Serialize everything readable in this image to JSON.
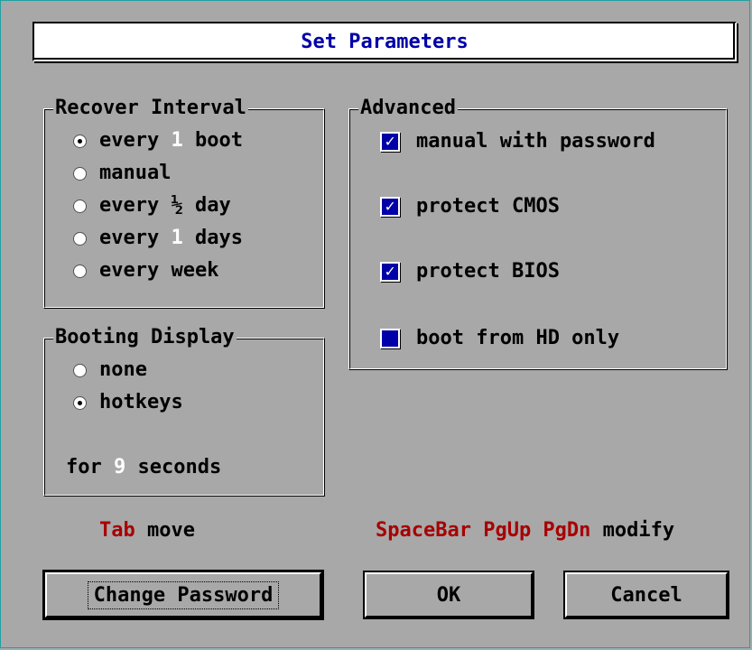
{
  "title": "Set Parameters",
  "recover_interval": {
    "legend": "Recover Interval",
    "options": [
      {
        "pre": "every ",
        "hl": "1",
        "post": " boot",
        "selected": true
      },
      {
        "pre": "manual",
        "hl": "",
        "post": "",
        "selected": false
      },
      {
        "pre": "every ½ day",
        "hl": "",
        "post": "",
        "selected": false
      },
      {
        "pre": "every ",
        "hl": "1",
        "post": " days",
        "selected": false
      },
      {
        "pre": "every week",
        "hl": "",
        "post": "",
        "selected": false
      }
    ]
  },
  "booting_display": {
    "legend": "Booting Display",
    "options": [
      {
        "label": "none",
        "selected": false
      },
      {
        "label": "hotkeys",
        "selected": true
      }
    ],
    "for_pre": "for ",
    "seconds_value": "9",
    "for_post": " seconds"
  },
  "advanced": {
    "legend": "Advanced",
    "items": [
      {
        "label": "manual with password",
        "checked": true
      },
      {
        "label": "protect CMOS",
        "checked": true
      },
      {
        "label": "protect BIOS",
        "checked": true
      },
      {
        "label": "boot from HD only",
        "checked": false
      }
    ]
  },
  "help": {
    "tab_key": "Tab",
    "tab_action": " move",
    "modify_keys": "SpaceBar PgUp PgDn",
    "modify_action": " modify"
  },
  "buttons": {
    "change_password": "Change Password",
    "ok": "OK",
    "cancel": "Cancel"
  },
  "colors": {
    "background": "#a8a8a8",
    "title_text": "#0000a8",
    "key_red": "#a80000",
    "checkbox_blue": "#0000a8",
    "highlight_value": "#ffffff"
  }
}
